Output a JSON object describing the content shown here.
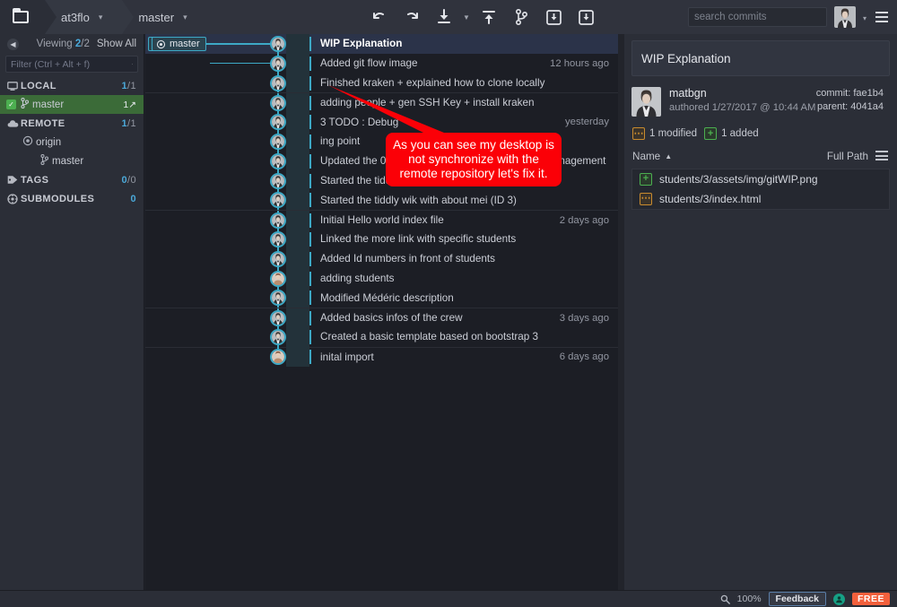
{
  "window": {
    "app": "GitKraken",
    "colors": {
      "accent_teal": "#3da9c6",
      "selected_branch_green": "#3b6b38",
      "callout_red": "#fb0007",
      "free_badge_orange": "#f2603c",
      "added_green": "#4caf50",
      "modified_orange": "#c98b2e"
    }
  },
  "topbar": {
    "repo_icon": "folder-icon",
    "breadcrumbs": [
      {
        "label": "at3flo",
        "caret": "▾"
      },
      {
        "label": "master",
        "caret": "▾"
      }
    ],
    "tools": [
      {
        "name": "undo-button",
        "icon": "undo-icon"
      },
      {
        "name": "redo-button",
        "icon": "redo-icon"
      },
      {
        "name": "pull-button",
        "icon": "pull-down-arrow-icon"
      },
      {
        "name": "pull-dropdown",
        "icon": "chevron-down-icon"
      },
      {
        "name": "push-button",
        "icon": "push-up-arrow-icon"
      },
      {
        "name": "branch-button",
        "icon": "branch-icon"
      },
      {
        "name": "stash-button",
        "icon": "stash-down-icon"
      },
      {
        "name": "pop-stash-button",
        "icon": "pop-stash-icon"
      }
    ],
    "search": {
      "placeholder": "search commits",
      "value": "",
      "icon": "search-icon"
    },
    "profile": {
      "icon": "avatar",
      "caret": "▾"
    },
    "menu_icon": "hamburger-menu-icon"
  },
  "sidebar": {
    "back_icon": "chevron-left-icon",
    "viewing_label": "Viewing",
    "viewing_count": "2",
    "viewing_total": "/2",
    "show_all": "Show All",
    "filter": {
      "placeholder": "Filter (Ctrl + Alt + f)",
      "value": "",
      "icon": "search-icon"
    },
    "sections": [
      {
        "name": "local",
        "icon": "monitor-icon",
        "label": "LOCAL",
        "count": "1",
        "total": "/1",
        "items": [
          {
            "label": "master",
            "icon": "branch-icon",
            "checked": true,
            "ahead": "1↗",
            "selected": true
          }
        ]
      },
      {
        "name": "remote",
        "icon": "cloud-icon",
        "label": "REMOTE",
        "count": "1",
        "total": "/1",
        "items": [
          {
            "label": "origin",
            "icon": "target-icon",
            "indent": 1
          },
          {
            "label": "master",
            "icon": "branch-icon",
            "indent": 2
          }
        ]
      },
      {
        "name": "tags",
        "icon": "tag-icon",
        "label": "TAGS",
        "count": "0",
        "total": "/0",
        "items": []
      },
      {
        "name": "submodules",
        "icon": "submodule-icon",
        "label": "SUBMODULES",
        "count": "",
        "total": "0",
        "items": []
      }
    ]
  },
  "graph": {
    "ref_local": {
      "label": "master",
      "icon": "monitor-icon"
    },
    "ref_remote": {
      "label": "master",
      "icon": "target-icon"
    },
    "commits": [
      {
        "message": "WIP Explanation",
        "when": "",
        "selected": true,
        "sep": false
      },
      {
        "message": "Added git flow image",
        "when": "12 hours ago",
        "sep": false
      },
      {
        "message": "Finished kraken + explained how to clone locally",
        "when": "",
        "sep": false
      },
      {
        "message": "adding people + gen SSH Key + install kraken",
        "when": "",
        "sep": true
      },
      {
        "message": "3 TODO : Debug",
        "when": "yesterday",
        "sep": false
      },
      {
        "message": "ing point",
        "when": "",
        "sep": false
      },
      {
        "message": "Updated the 01 principles and practices, project management",
        "when": "",
        "sep": false
      },
      {
        "message": "Started the tiddler about GIT",
        "when": "",
        "sep": false
      },
      {
        "message": "Started the tiddly wik with about mei (ID 3)",
        "when": "",
        "sep": false
      },
      {
        "message": "Initial Hello world index file",
        "when": "2 days ago",
        "sep": true
      },
      {
        "message": "Linked the more link with specific students",
        "when": "",
        "sep": false
      },
      {
        "message": "Added Id numbers in front of students",
        "when": "",
        "sep": false
      },
      {
        "message": "adding students",
        "when": "",
        "sep": false,
        "face": "alt"
      },
      {
        "message": "Modified Médéric description",
        "when": "",
        "sep": false
      },
      {
        "message": "Added basics infos of the crew",
        "when": "3 days ago",
        "sep": true
      },
      {
        "message": "Created a basic template based on bootstrap 3",
        "when": "",
        "sep": false
      },
      {
        "message": "inital import",
        "when": "6 days ago",
        "sep": true,
        "face": "alt"
      }
    ]
  },
  "callout": {
    "text": "As you can see my desktop is not synchronize with the remote repository let's fix it."
  },
  "detail": {
    "title": "WIP Explanation",
    "author": "matbgn",
    "authored": "authored 1/27/2017 @ 10:44 AM",
    "commit_label": "commit:",
    "commit_hash": "fae1b4",
    "parent_label": "parent:",
    "parent_hash": "4041a4",
    "stats": [
      {
        "icon": "modified-icon",
        "label": "1 modified",
        "kind": "mod"
      },
      {
        "icon": "added-icon",
        "label": "1 added",
        "kind": "add"
      }
    ],
    "columns": {
      "name": "Name",
      "sort_arrow": "▲",
      "full_path": "Full Path",
      "list_icon": "list-view-icon"
    },
    "files": [
      {
        "name": "students/3/assets/img/gitWIP.png",
        "kind": "add",
        "icon": "added-icon"
      },
      {
        "name": "students/3/index.html",
        "kind": "mod",
        "icon": "modified-icon"
      }
    ]
  },
  "statusbar": {
    "zoom_icon": "magnifier-icon",
    "zoom_level": "100%",
    "feedback": "Feedback",
    "account_icon": "account-icon",
    "plan_badge": "FREE"
  }
}
